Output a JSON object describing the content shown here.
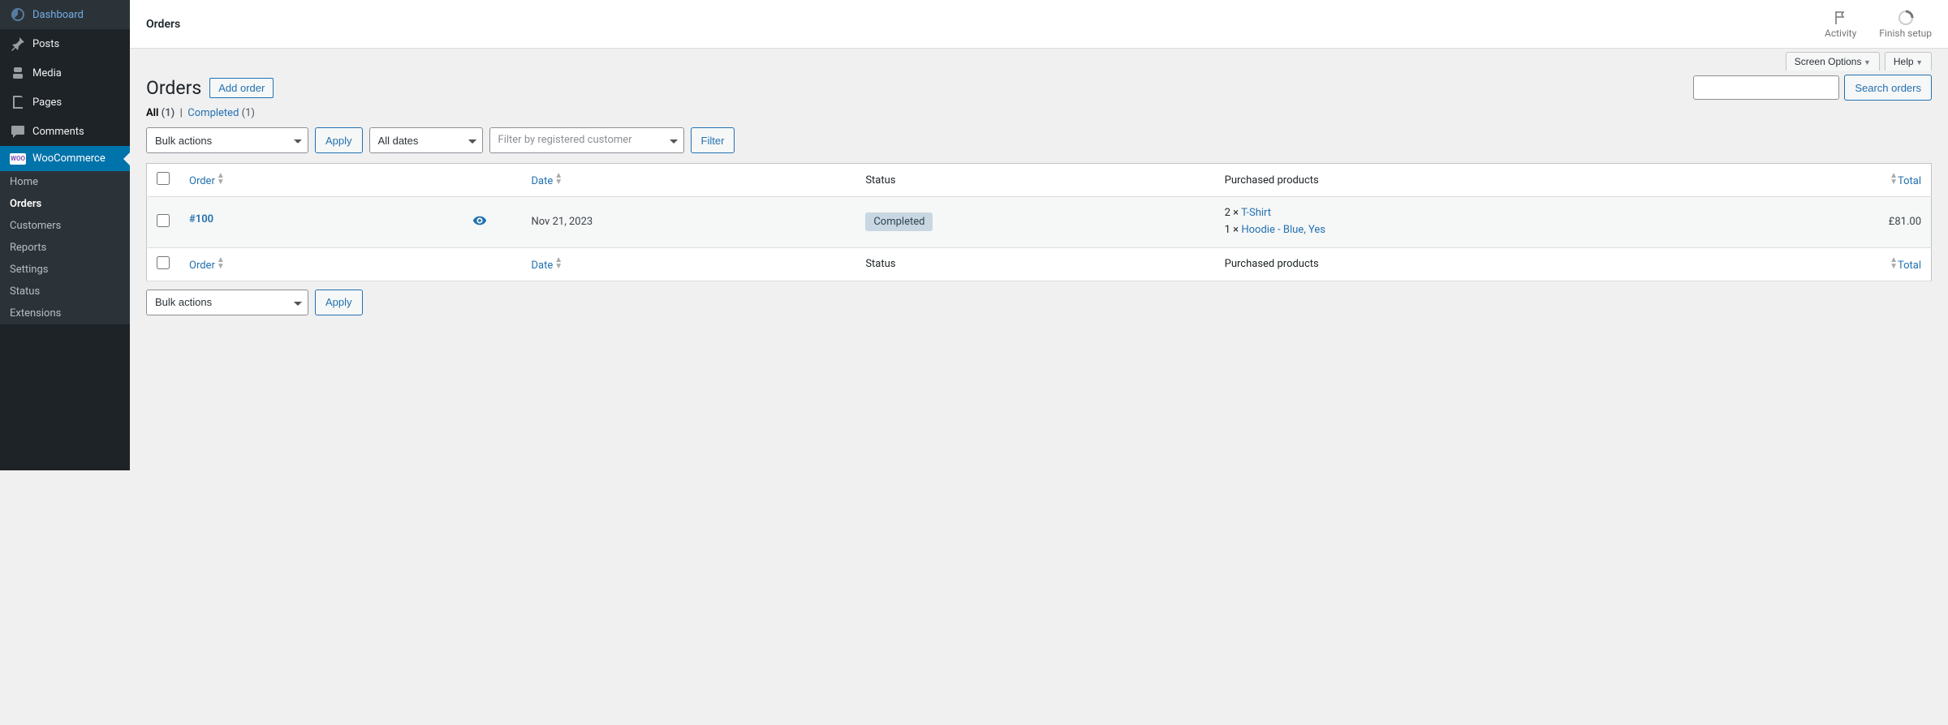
{
  "sidebar": {
    "items": [
      {
        "label": "Dashboard",
        "icon": "dashboard-icon"
      },
      {
        "label": "Posts",
        "icon": "pin-icon"
      },
      {
        "label": "Media",
        "icon": "media-icon"
      },
      {
        "label": "Pages",
        "icon": "page-icon"
      },
      {
        "label": "Comments",
        "icon": "comment-icon"
      },
      {
        "label": "WooCommerce",
        "icon": "woo-icon"
      }
    ],
    "submenu": [
      {
        "label": "Home"
      },
      {
        "label": "Orders"
      },
      {
        "label": "Customers"
      },
      {
        "label": "Reports"
      },
      {
        "label": "Settings"
      },
      {
        "label": "Status"
      },
      {
        "label": "Extensions"
      }
    ]
  },
  "topbar": {
    "title": "Orders",
    "activity": "Activity",
    "finish_setup": "Finish setup"
  },
  "tabs": {
    "screen_options": "Screen Options",
    "help": "Help"
  },
  "page": {
    "heading": "Orders",
    "add_order": "Add order"
  },
  "views": {
    "all_label": "All",
    "all_count": "(1)",
    "separator": "|",
    "completed_label": "Completed",
    "completed_count": "(1)"
  },
  "filters": {
    "bulk_actions": "Bulk actions",
    "apply": "Apply",
    "all_dates": "All dates",
    "customer_placeholder": "Filter by registered customer",
    "filter": "Filter"
  },
  "search": {
    "button": "Search orders"
  },
  "table": {
    "columns": {
      "order": "Order",
      "date": "Date",
      "status": "Status",
      "purchased": "Purchased products",
      "total": "Total"
    },
    "rows": [
      {
        "id": "#100",
        "date": "Nov 21, 2023",
        "status": "Completed",
        "products": [
          {
            "qty": "2 × ",
            "name": "T-Shirt"
          },
          {
            "qty": "1 × ",
            "name": "Hoodie - Blue, Yes"
          }
        ],
        "total": "£81.00"
      }
    ]
  }
}
